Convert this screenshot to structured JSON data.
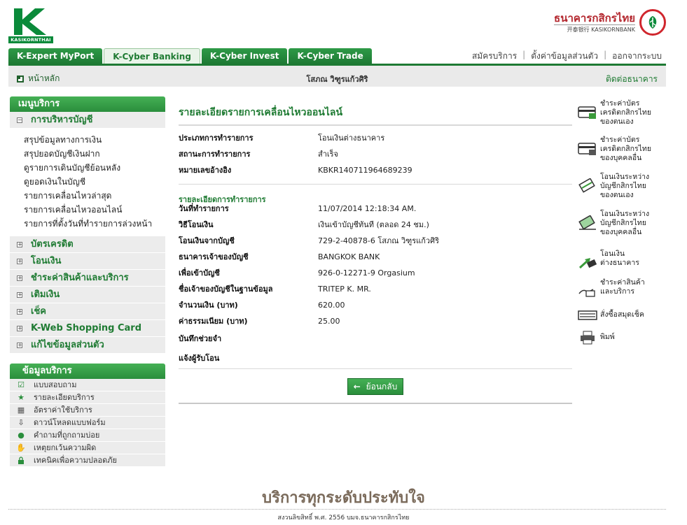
{
  "brand": {
    "kasikorn_wordmark": "KASIKORNTHAI",
    "bank_thai": "ธนาคารกสิกรไทย",
    "bank_eng": "开泰银行 KASIKORNBANK",
    "color_green": "#1e7a34",
    "color_red": "#d0262d"
  },
  "tabs": [
    {
      "label": "K-Expert MyPort",
      "active": false
    },
    {
      "label": "K-Cyber Banking",
      "active": true
    },
    {
      "label": "K-Cyber Invest",
      "active": false
    },
    {
      "label": "K-Cyber Trade",
      "active": false
    }
  ],
  "top_links": {
    "register": "สมัครบริการ",
    "settings": "ตั้งค่าข้อมูลส่วนตัว",
    "logout": "ออกจากระบบ"
  },
  "subbar": {
    "home": "หน้าหลัก",
    "user_name": "โสภณ วิฑูรแก้วศิริ",
    "contact": "ติดต่อธนาคาร"
  },
  "sidebar": {
    "header": "เมนูบริการ",
    "account_section": "การบริหารบัญชี",
    "account_items": [
      "สรุปข้อมูลทางการเงิน",
      "สรุปยอดบัญชีเงินฝาก",
      "ดูรายการเดินบัญชีย้อนหลัง",
      "ดูยอดเงินในบัญชี",
      "รายการเคลื่อนไหวล่าสุด",
      "รายการเคลื่อนไหวออนไลน์",
      "รายการที่ตั้งวันที่ทำรายการล่วงหน้า"
    ],
    "sections": [
      "บัตรเครดิต",
      "โอนเงิน",
      "ชำระค่าสินค้าและบริการ",
      "เติมเงิน",
      "เช็ค",
      "K-Web Shopping Card",
      "แก้ไขข้อมูลส่วนตัว"
    ]
  },
  "info_box": {
    "header": "ข้อมูลบริการ",
    "items": [
      {
        "label": "แบบสอบถาม",
        "icon": "checkbox-icon"
      },
      {
        "label": "รายละเอียดบริการ",
        "icon": "star-icon"
      },
      {
        "label": "อัตราค่าใช้บริการ",
        "icon": "calculator-icon"
      },
      {
        "label": "ดาวน์โหลดแบบฟอร์ม",
        "icon": "download-icon"
      },
      {
        "label": "คำถามที่ถูกถามบ่อย",
        "icon": "question-icon"
      },
      {
        "label": "เหตุยกเว้นความผิด",
        "icon": "handshake-icon"
      },
      {
        "label": "เทคนิคเพื่อความปลอดภัย",
        "icon": "lock-icon"
      }
    ]
  },
  "main": {
    "title": "รายละเอียดรายการเคลื่อนไหวออนไลน์",
    "summary": [
      {
        "label": "ประเภทการทำรายการ",
        "value": "โอนเงินต่างธนาคาร"
      },
      {
        "label": "สถานะการทำรายการ",
        "value": "สำเร็จ"
      },
      {
        "label": "หมายเลขอ้างอิง",
        "value": "KBKR140711964689239"
      }
    ],
    "detail_title": "รายละเอียดการทำรายการ",
    "details": [
      {
        "label": "วันที่ทำรายการ",
        "value": "11/07/2014 12:18:34 AM."
      },
      {
        "label": "วิธีโอนเงิน",
        "value": "เงินเข้าบัญชีทันที (ตลอด 24 ชม.)"
      },
      {
        "label": "โอนเงินจากบัญชี",
        "value": "729-2-40878-6 โสภณ วิฑูรแก้วศิริ"
      },
      {
        "label": "ธนาคารเจ้าของบัญชี",
        "value": "BANGKOK BANK"
      },
      {
        "label": "เพื่อเข้าบัญชี",
        "value": "926-0-12271-9 Orgasium"
      },
      {
        "label": "ชื่อเจ้าของบัญชีในฐานข้อมูล",
        "value": "TRITEP K. MR."
      },
      {
        "label": "จำนวนเงิน (บาท)",
        "value": "620.00"
      },
      {
        "label": "ค่าธรรมเนียม (บาท)",
        "value": "25.00"
      },
      {
        "label": "บันทึกช่วยจำ",
        "value": ""
      },
      {
        "label": "แจ้งผู้รับโอน",
        "value": ""
      }
    ],
    "back_button": "ย้อนกลับ"
  },
  "quick_links": [
    {
      "lines": [
        "ชำระค่าบัตร",
        "เครดิตกสิกรไทย",
        "ของตนเอง"
      ],
      "icon": "credit-card-icon"
    },
    {
      "lines": [
        "ชำระค่าบัตร",
        "เครดิตกสิกรไทย",
        "ของบุคคลอื่น"
      ],
      "icon": "credit-card-other-icon"
    },
    {
      "lines": [
        "โอนเงินระหว่าง",
        "บัญชีกสิกรไทย",
        "ของตนเอง"
      ],
      "icon": "transfer-own-icon"
    },
    {
      "lines": [
        "โอนเงินระหว่าง",
        "บัญชีกสิกรไทย",
        "ของบุคคลอื่น"
      ],
      "icon": "transfer-other-icon"
    },
    {
      "lines": [
        "โอนเงิน",
        "ต่างธนาคาร"
      ],
      "icon": "interbank-transfer-icon"
    },
    {
      "lines": [
        "ชำระค่าสินค้า",
        "และบริการ"
      ],
      "icon": "bill-payment-icon"
    },
    {
      "lines": [
        "สั่งซื้อสมุดเช็ค"
      ],
      "icon": "checkbook-icon"
    },
    {
      "lines": [
        "พิมพ์"
      ],
      "icon": "print-icon"
    }
  ],
  "footer": {
    "slogan": "บริการทุกระดับประทับใจ",
    "copyright": "สงวนลิขสิทธิ์ พ.ศ. 2556 บมจ.ธนาคารกสิกรไทย"
  }
}
